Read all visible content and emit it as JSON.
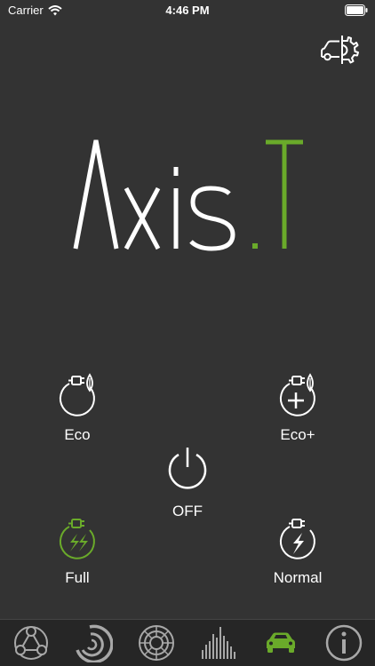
{
  "status_bar": {
    "carrier": "Carrier",
    "time": "4:46 PM"
  },
  "logo": {
    "text_main": "Axis",
    "text_dot": ".",
    "text_accent": "T"
  },
  "modes": {
    "eco": {
      "label": "Eco",
      "icon": "plug-leaf-icon"
    },
    "eco_plus": {
      "label": "Eco+",
      "icon": "plug-plus-leaf-icon"
    },
    "off": {
      "label": "OFF",
      "icon": "power-icon"
    },
    "full": {
      "label": "Full",
      "icon": "plug-double-bolt-icon",
      "active": true
    },
    "normal": {
      "label": "Normal",
      "icon": "plug-bolt-icon"
    }
  },
  "tabs": [
    {
      "name": "network",
      "icon": "network-nodes-icon"
    },
    {
      "name": "gauge",
      "icon": "arc-gauge-icon"
    },
    {
      "name": "dial",
      "icon": "segmented-dial-icon"
    },
    {
      "name": "levels",
      "icon": "bar-levels-icon"
    },
    {
      "name": "car",
      "icon": "car-icon",
      "selected": true
    },
    {
      "name": "info",
      "icon": "info-icon"
    }
  ],
  "colors": {
    "background": "#333333",
    "accent": "#6aaa2a",
    "tabbar": "#262626",
    "icon_grey": "#a8a8a8"
  }
}
